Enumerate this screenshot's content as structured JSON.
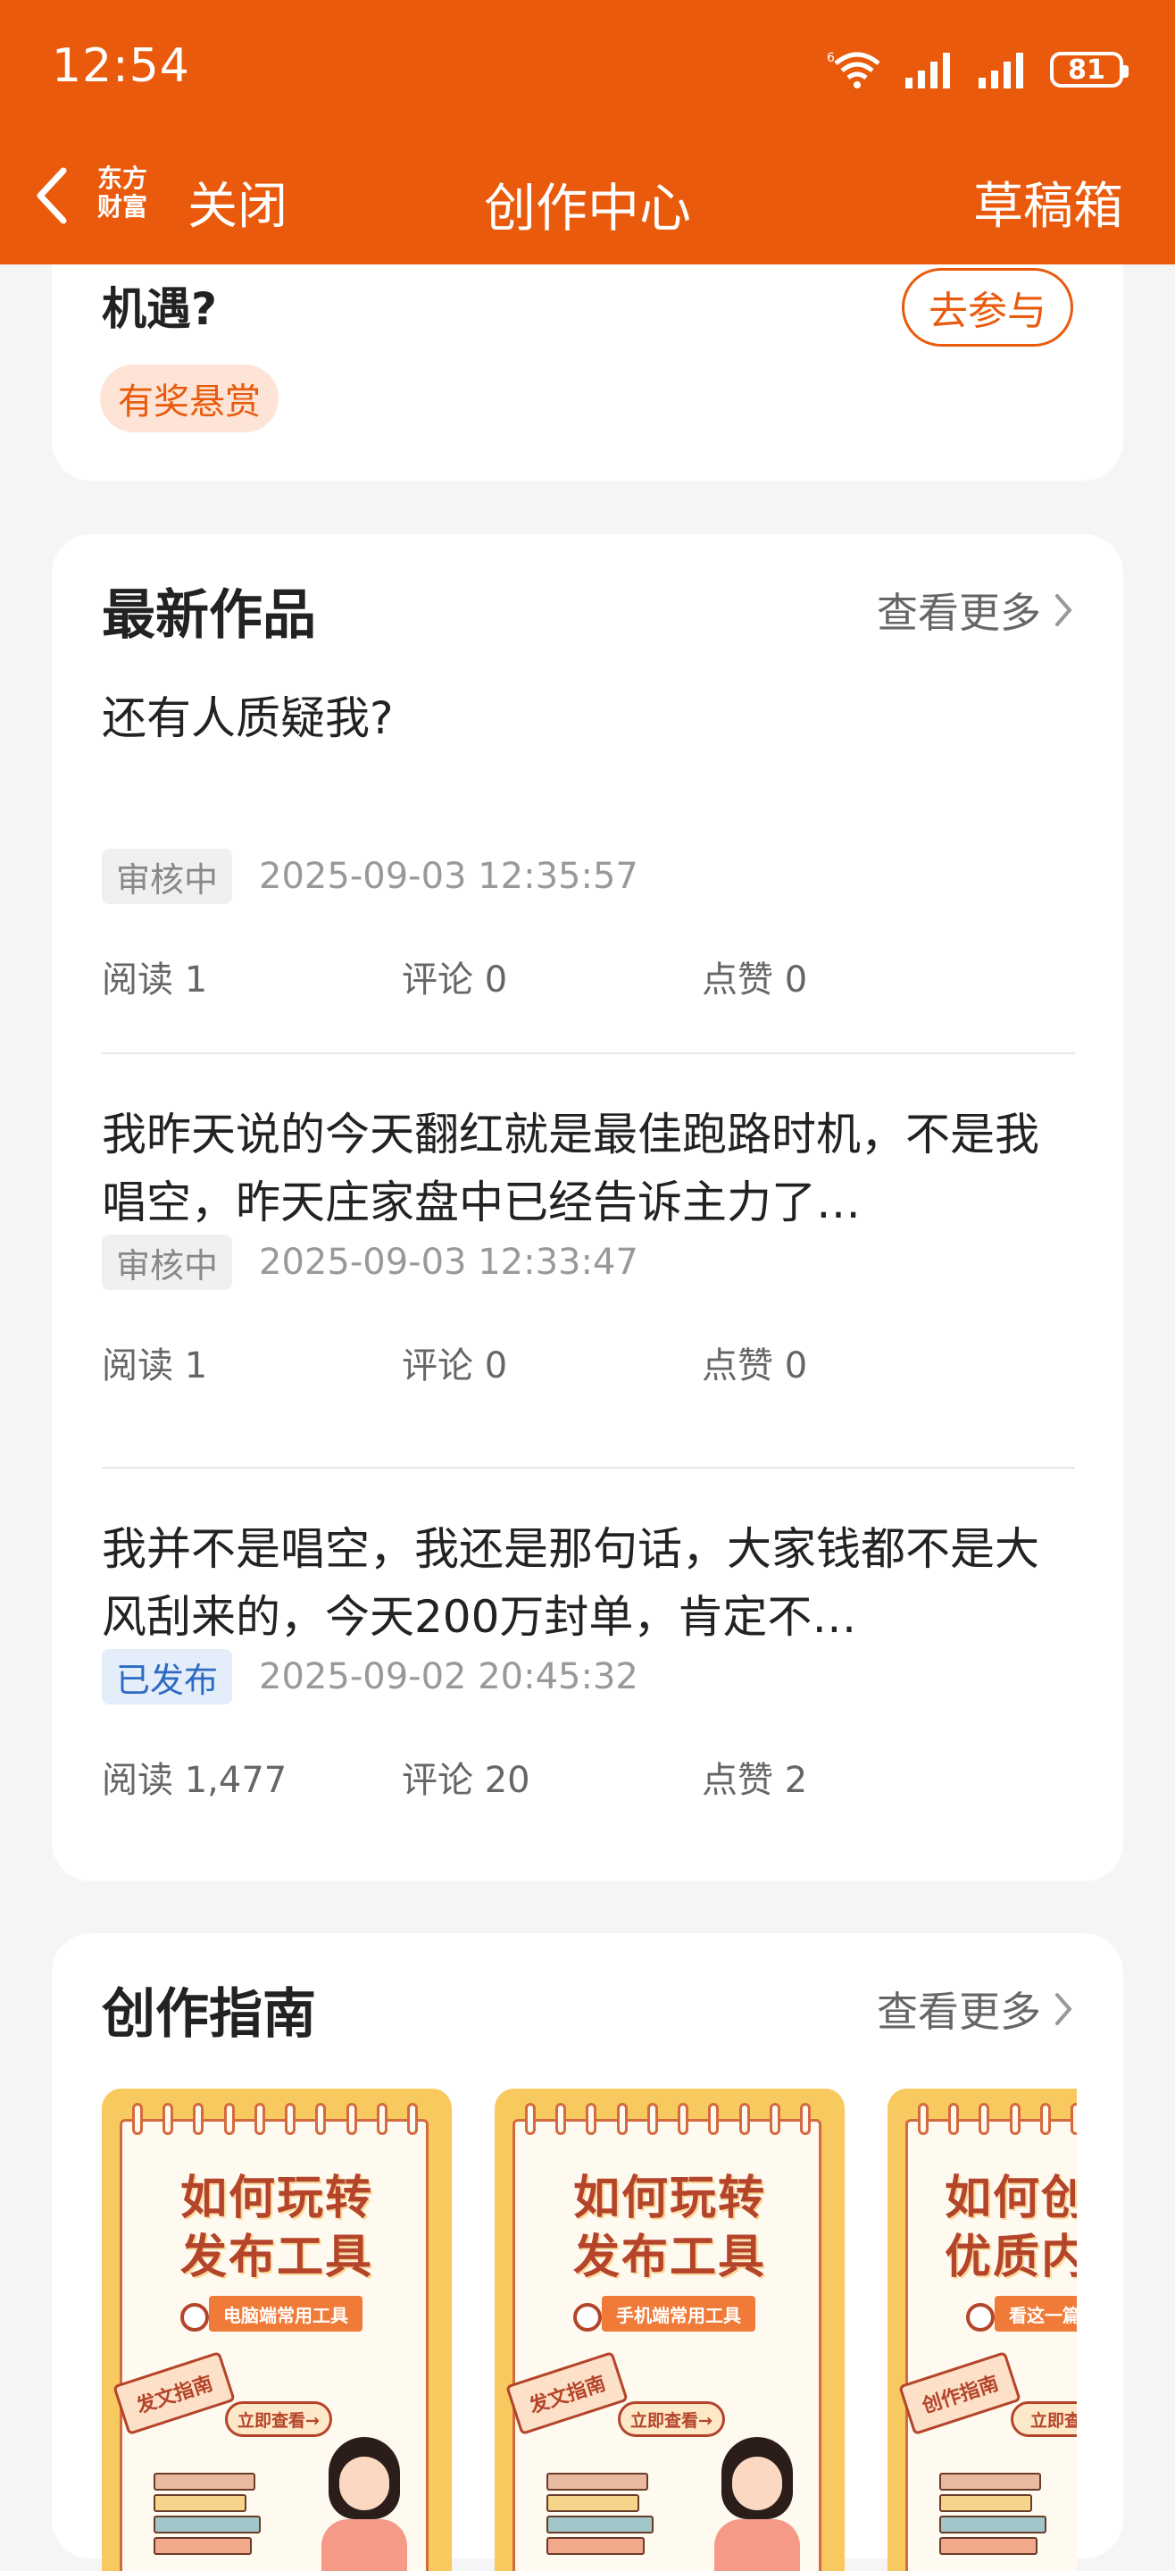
{
  "status_bar": {
    "time": "12:54",
    "battery": "81"
  },
  "header": {
    "logo_top": "东方",
    "logo_bottom": "财富",
    "close_label": "关闭",
    "title": "创作中心",
    "drafts_label": "草稿箱",
    "color": "#e95a0c"
  },
  "topic_card": {
    "title": "机遇?",
    "join_label": "去参与",
    "badge": "有奖悬赏"
  },
  "latest": {
    "title": "最新作品",
    "more_label": "查看更多",
    "posts": [
      {
        "title": "还有人质疑我?",
        "status": "审核中",
        "time": "2025-09-03 12:35:57",
        "reads": "阅读 1",
        "comments": "评论 0",
        "likes": "点赞 0"
      },
      {
        "title": "我昨天说的今天翻红就是最佳跑路时机，不是我唱空，昨天庄家盘中已经告诉主力了…",
        "status": "审核中",
        "time": "2025-09-03 12:33:47",
        "reads": "阅读 1",
        "comments": "评论 0",
        "likes": "点赞 0"
      },
      {
        "title": "我并不是唱空，我还是那句话，大家钱都不是大风刮来的，今天200万封单，肯定不…",
        "status": "已发布",
        "time": "2025-09-02 20:45:32",
        "reads": "阅读 1,477",
        "comments": "评论 20",
        "likes": "点赞 2"
      }
    ]
  },
  "guide": {
    "title": "创作指南",
    "more_label": "查看更多",
    "cards": [
      {
        "line1": "如何玩转",
        "line2": "发布工具",
        "sub": "电脑端常用工具",
        "tag": "发文指南",
        "button": "立即查看→"
      },
      {
        "line1": "如何玩转",
        "line2": "发布工具",
        "sub": "手机端常用工具",
        "tag": "发文指南",
        "button": "立即查看→"
      },
      {
        "line1": "如何创",
        "line2": "优质内",
        "sub": "看这一篇",
        "tag": "创作指南",
        "button": "立即查看"
      }
    ]
  }
}
